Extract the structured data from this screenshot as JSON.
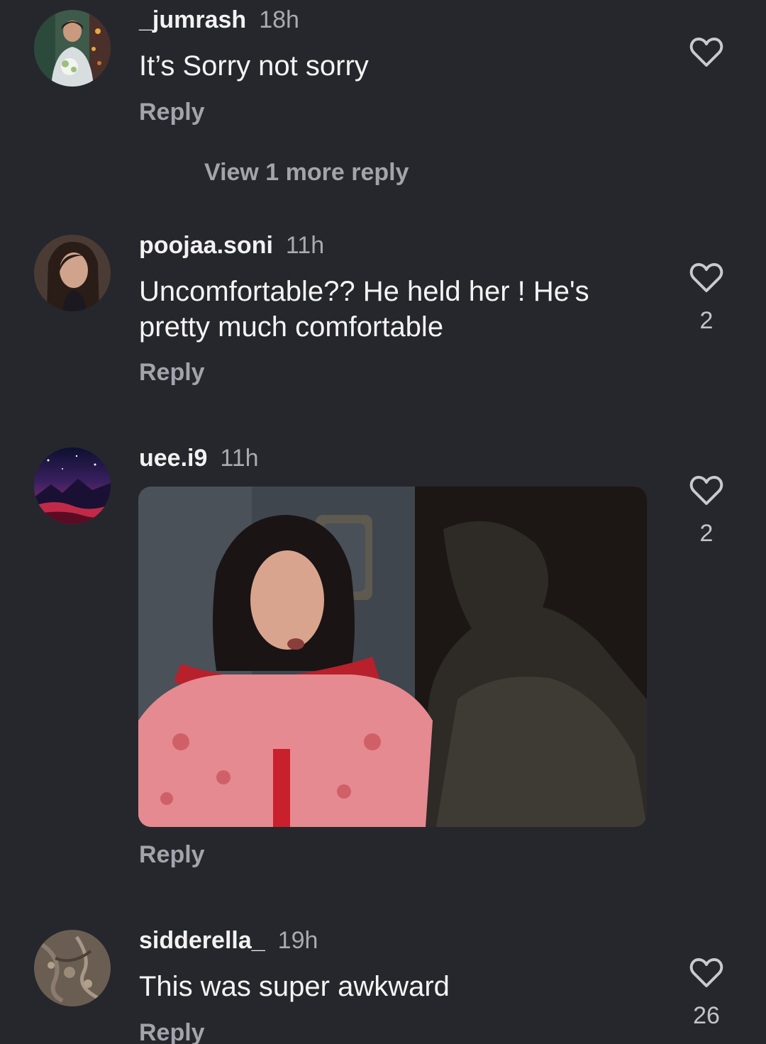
{
  "comments": [
    {
      "username": "_jumrash",
      "time": "18h",
      "text": "It’s Sorry not sorry",
      "reply_label": "Reply",
      "view_more_label": "View 1 more reply",
      "likes": ""
    },
    {
      "username": "poojaa.soni",
      "time": "11h",
      "text": "Uncomfortable?? He held her ! He's pretty much comfortable",
      "reply_label": "Reply",
      "likes": "2"
    },
    {
      "username": "uee.i9",
      "time": "11h",
      "text": "",
      "reply_label": "Reply",
      "likes": "2"
    },
    {
      "username": "sidderella_",
      "time": "19h",
      "text": "This was super awkward",
      "reply_label": "Reply",
      "likes": "26"
    }
  ],
  "icons": {
    "like": "heart-outline-icon"
  },
  "colors": {
    "background": "#26272c",
    "secondary_text": "#a3a4ab"
  }
}
